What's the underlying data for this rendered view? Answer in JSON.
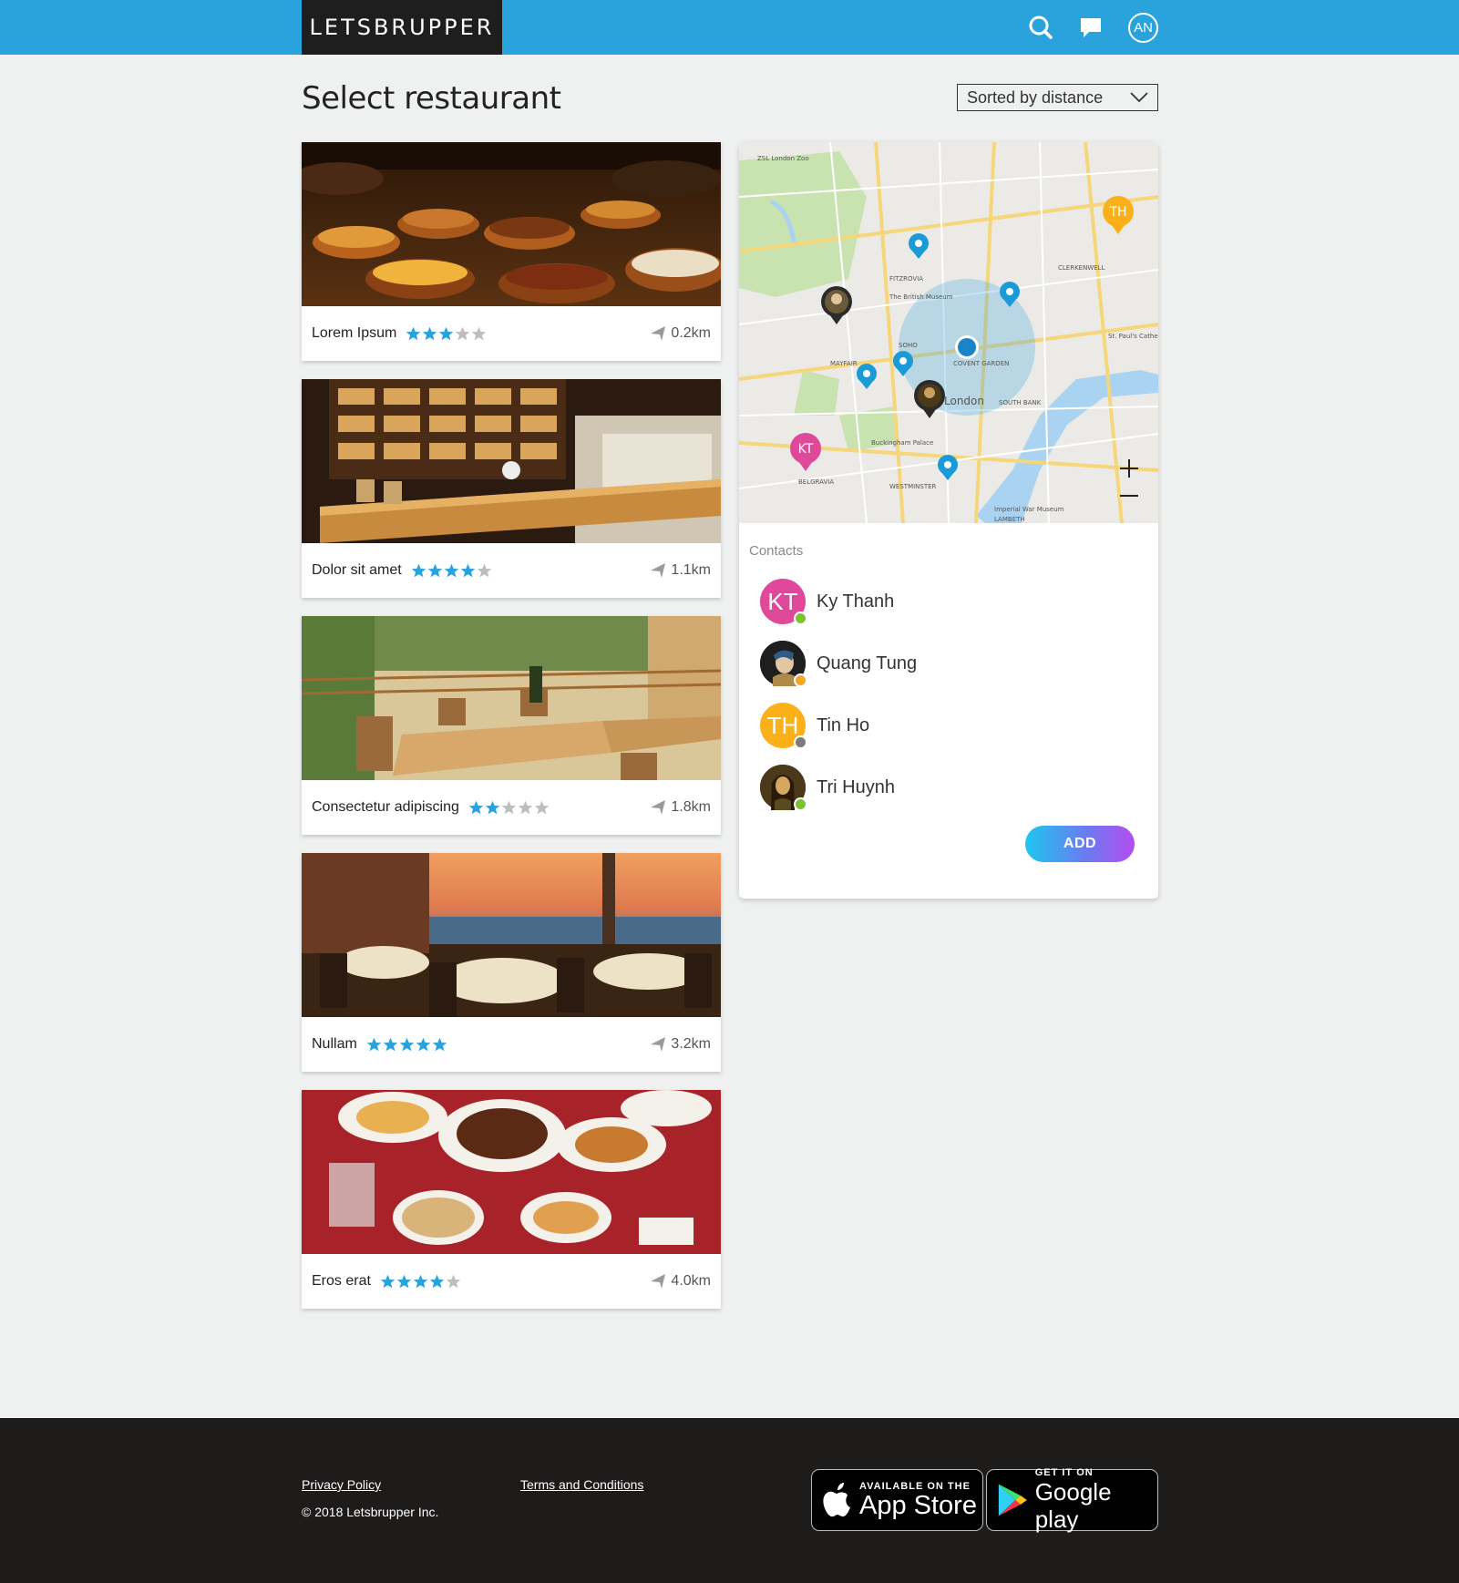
{
  "header": {
    "logo_text": "LETSBRUPPER",
    "search_icon": "search-icon",
    "chat_icon": "chat-bubble-icon",
    "user_initials": "AN",
    "bar_color": "#2aa3dc"
  },
  "page": {
    "title": "Select restaurant",
    "sort_selected": "Sorted by distance"
  },
  "restaurants": [
    {
      "name": "Lorem Ipsum",
      "rating": 3,
      "max_rating": 5,
      "distance": "0.2km"
    },
    {
      "name": "Dolor sit amet",
      "rating": 4,
      "max_rating": 5,
      "distance": "1.1km"
    },
    {
      "name": "Consectetur adipiscing",
      "rating": 2,
      "max_rating": 5,
      "distance": "1.8km"
    },
    {
      "name": "Nullam",
      "rating": 5,
      "max_rating": 5,
      "distance": "3.2km"
    },
    {
      "name": "Eros erat",
      "rating": 4,
      "max_rating": 5,
      "distance": "4.0km"
    }
  ],
  "map": {
    "labels": [
      "ZSL London Zoo",
      "FITZROVIA",
      "The British Museum",
      "CLERKENWELL",
      "SOHO",
      "MAYFAIR",
      "COVENT GARDEN",
      "London",
      "SOUTH BANK",
      "Buckingham Palace",
      "BELGRAVIA",
      "WESTMINSTER",
      "Imperial War Museum",
      "LAMBETH",
      "St. Paul's Cathedral"
    ],
    "pin_initials": [
      "KT",
      "TH"
    ],
    "zoom_in": "+",
    "zoom_out": "−"
  },
  "contacts": {
    "label": "Contacts",
    "items": [
      {
        "initials": "KT",
        "name": "Ky Thanh",
        "avatar_color": "#e0489a",
        "status_color": "#7ac32a"
      },
      {
        "initials": "",
        "name": "Quang Tung",
        "avatar_color": "#2c2a2a",
        "status_color": "#f5a623"
      },
      {
        "initials": "TH",
        "name": "Tin Ho",
        "avatar_color": "#fbb019",
        "status_color": "#7b7b7b"
      },
      {
        "initials": "",
        "name": "Tri Huynh",
        "avatar_color": "#3a2a12",
        "status_color": "#7ac32a"
      }
    ],
    "add_label": "ADD"
  },
  "footer": {
    "privacy": "Privacy Policy",
    "terms": "Terms and Conditions",
    "copyright": "© 2018 Letsbrupper Inc.",
    "appstore_small": "AVAILABLE ON THE",
    "appstore_big": "App Store",
    "google_small": "GET IT ON",
    "google_big": "Google play"
  },
  "colors": {
    "accent": "#2aa3dc",
    "star_on": "#2aa3dc",
    "star_off": "#bdbdbd"
  }
}
